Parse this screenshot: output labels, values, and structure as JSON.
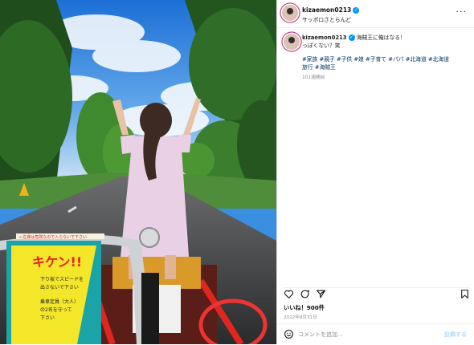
{
  "post": {
    "username": "kizaemon0213",
    "location": "サッポロさとらんど",
    "caption_text": "海賊王に俺はなる！",
    "caption_line2": "っぽくない？笑",
    "hashtags": "#家族 #親子 #子供 #娘 #子育て #パパ #北海道 #北海道旅行 #海賊王",
    "time_ago": "101週間前",
    "likes": "いいね！900件",
    "date": "2022年8月31日",
    "comment_placeholder": "コメントを追加...",
    "post_button": "投稿する",
    "more_glyph": "···",
    "verified_glyph": "✓"
  },
  "photo": {
    "sign_title": "キケン!!",
    "sign_line1": "下り坂でスピードを",
    "sign_line2": "出さないで下さい",
    "sign_line3": "乗車定員（大人）",
    "sign_line4": "の2名を守って",
    "sign_line5": "下さい",
    "strip_text": "←左側は危険なので入らないで下さい",
    "colors": {
      "sky": "#2f87e0",
      "trees": "#1f5a1f",
      "road": "#3c3d3f",
      "dress": "#e9cbe0",
      "sign_bg": "#f4e72a",
      "sign_border": "#1aa4a8",
      "sign_title": "#e8241b"
    }
  },
  "icons": [
    "heart-icon",
    "comment-icon",
    "share-icon",
    "bookmark-icon",
    "emoji-icon",
    "more-icon"
  ]
}
